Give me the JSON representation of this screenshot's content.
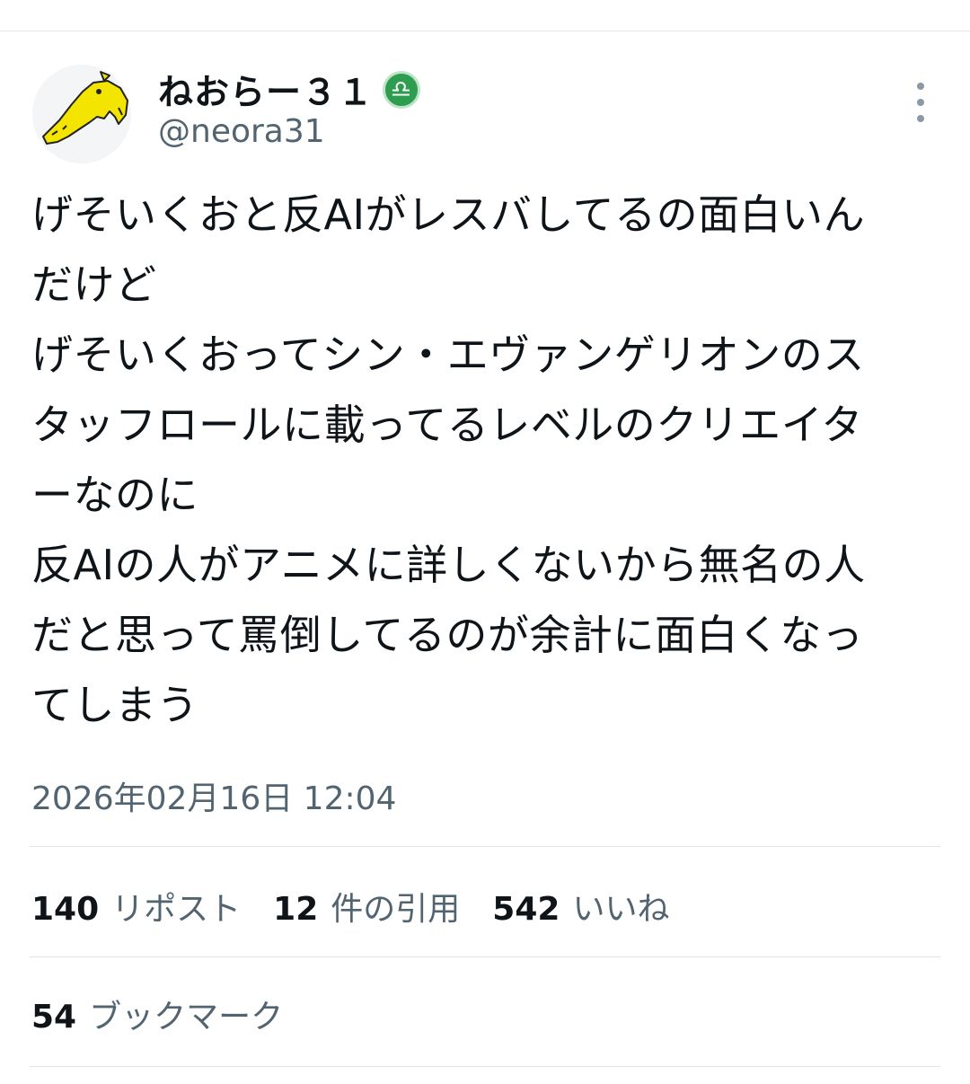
{
  "tweet": {
    "author": {
      "display_name": "ねおらー３１",
      "badge_icon": "libra-icon",
      "badge_glyph": "♎",
      "handle": "@neora31",
      "avatar_icon": "yellow-dog-avatar"
    },
    "text": "げそいくおと反AIがレスバしてるの面白いん\nだけど\nげそいくおってシン・エヴァンゲリオンのス\nタッフロールに載ってるレベルのクリエイタ\nーなのに\n反AIの人がアニメに詳しくないから無名の人\nだと思って罵倒してるのが余計に面白くなっ\nてしまう",
    "timestamp": "2026年02月16日 12:04",
    "stats": {
      "reposts": {
        "count": "140",
        "label": "リポスト"
      },
      "quotes": {
        "count": "12",
        "label": "件の引用"
      },
      "likes": {
        "count": "542",
        "label": "いいね"
      },
      "bookmarks": {
        "count": "54",
        "label": "ブックマーク"
      }
    }
  },
  "colors": {
    "text_primary": "#0f1419",
    "text_secondary": "#536471",
    "divider": "#e1e5e8",
    "badge_green": "#2e9d4f",
    "avatar_yellow": "#f3e500"
  }
}
